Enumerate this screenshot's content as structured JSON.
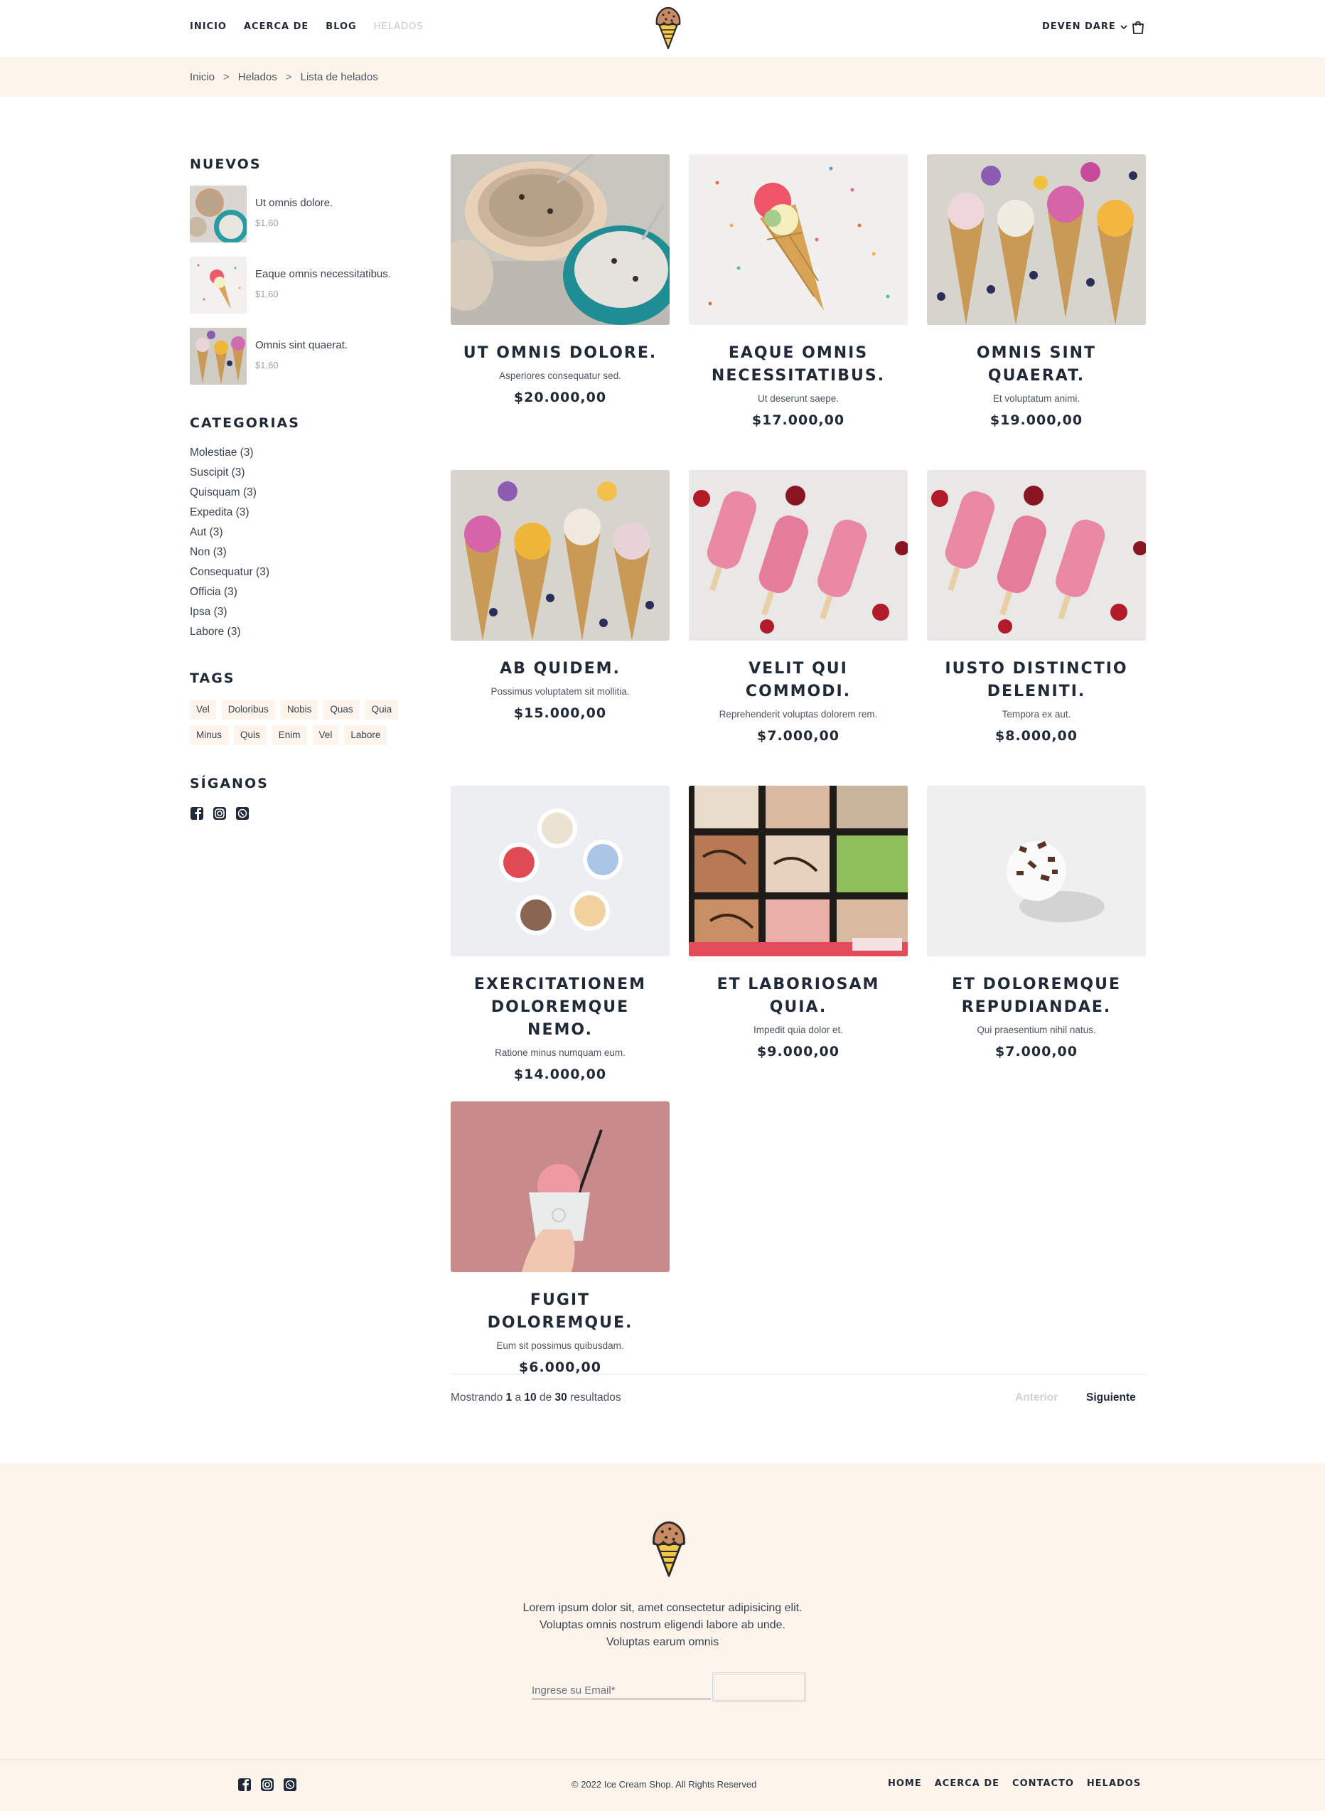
{
  "header": {
    "nav": [
      "INICIO",
      "ACERCA DE",
      "BLOG",
      "HELADOS"
    ],
    "user": "DEVEN DARE"
  },
  "breadcrumb": [
    "Inicio",
    "Helados",
    "Lista de helados"
  ],
  "sidebar": {
    "new_title": "NUEVOS",
    "new_items": [
      {
        "name": "Ut omnis dolore.",
        "price": "$1,60"
      },
      {
        "name": "Eaque omnis necessitatibus.",
        "price": "$1,60"
      },
      {
        "name": "Omnis sint quaerat.",
        "price": "$1,60"
      }
    ],
    "categories_title": "CATEGORIAS",
    "categories": [
      "Molestiae (3)",
      "Suscipit (3)",
      "Quisquam (3)",
      "Expedita (3)",
      "Aut (3)",
      "Non (3)",
      "Consequatur (3)",
      "Officia (3)",
      "Ipsa (3)",
      "Labore (3)"
    ],
    "tags_title": "TAGS",
    "tags": [
      "Vel",
      "Doloribus",
      "Nobis",
      "Quas",
      "Quia",
      "Minus",
      "Quis",
      "Enim",
      "Vel",
      "Labore"
    ],
    "follow_title": "SÍGANOS"
  },
  "products": [
    {
      "title": "UT OMNIS DOLORE.",
      "desc": "Asperiores consequatur sed.",
      "price": "$20.000,00"
    },
    {
      "title": "EAQUE OMNIS NECESSITATIBUS.",
      "desc": "Ut deserunt saepe.",
      "price": "$17.000,00"
    },
    {
      "title": "OMNIS SINT QUAERAT.",
      "desc": "Et voluptatum animi.",
      "price": "$19.000,00"
    },
    {
      "title": "AB QUIDEM.",
      "desc": "Possimus voluptatem sit mollitia.",
      "price": "$15.000,00"
    },
    {
      "title": "VELIT QUI COMMODI.",
      "desc": "Reprehenderit voluptas dolorem rem.",
      "price": "$7.000,00"
    },
    {
      "title": "IUSTO DISTINCTIO DELENITI.",
      "desc": "Tempora ex aut.",
      "price": "$8.000,00"
    },
    {
      "title": "EXERCITATIONEM DOLOREMQUE NEMO.",
      "desc": "Ratione minus numquam eum.",
      "price": "$14.000,00"
    },
    {
      "title": "ET LABORIOSAM QUIA.",
      "desc": "Impedit quia dolor et.",
      "price": "$9.000,00"
    },
    {
      "title": "ET DOLOREMQUE REPUDIANDAE.",
      "desc": "Qui praesentium nihil natus.",
      "price": "$7.000,00"
    },
    {
      "title": "FUGIT DOLOREMQUE.",
      "desc": "Eum sit possimus quibusdam.",
      "price": "$6.000,00"
    }
  ],
  "pagination": {
    "prefix": "Mostrando",
    "from": "1",
    "a": "a",
    "to": "10",
    "de": "de",
    "total": "30",
    "suffix": "resultados",
    "prev": "Anterior",
    "next": "Siguiente"
  },
  "footer": {
    "text": "Lorem ipsum dolor sit, amet consectetur adipisicing elit. Voluptas omnis nostrum eligendi labore ab unde. Voluptas earum omnis",
    "email_placeholder": "Ingrese su Email*",
    "copyright": "© 2022 Ice Cream Shop. All Rights Reserved",
    "nav": [
      "HOME",
      "ACERCA DE",
      "CONTACTO",
      "HELADOS"
    ]
  },
  "colors": {
    "cream": "#fdf5ec",
    "text": "#1f2937",
    "muted": "#c3c7ce"
  },
  "icons": [
    "ice-cream-logo-icon",
    "chevron-down-icon",
    "shopping-bag-icon",
    "facebook-icon",
    "instagram-icon",
    "whatsapp-icon"
  ]
}
